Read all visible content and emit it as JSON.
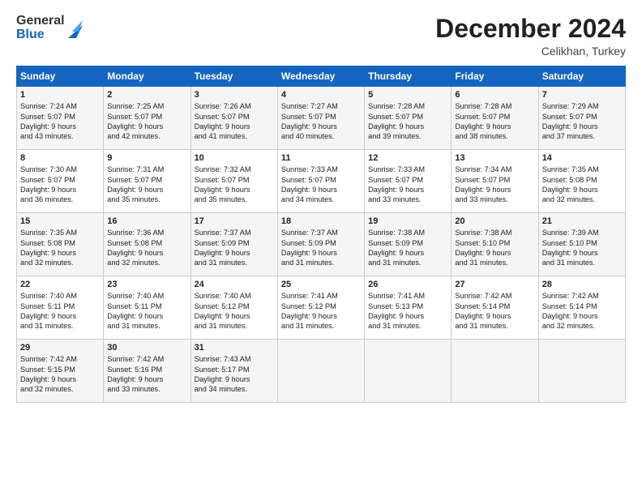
{
  "logo": {
    "line1": "General",
    "line2": "Blue"
  },
  "header": {
    "month": "December 2024",
    "location": "Celikhan, Turkey"
  },
  "weekdays": [
    "Sunday",
    "Monday",
    "Tuesday",
    "Wednesday",
    "Thursday",
    "Friday",
    "Saturday"
  ],
  "weeks": [
    [
      {
        "day": "1",
        "lines": [
          "Sunrise: 7:24 AM",
          "Sunset: 5:07 PM",
          "Daylight: 9 hours",
          "and 43 minutes."
        ]
      },
      {
        "day": "2",
        "lines": [
          "Sunrise: 7:25 AM",
          "Sunset: 5:07 PM",
          "Daylight: 9 hours",
          "and 42 minutes."
        ]
      },
      {
        "day": "3",
        "lines": [
          "Sunrise: 7:26 AM",
          "Sunset: 5:07 PM",
          "Daylight: 9 hours",
          "and 41 minutes."
        ]
      },
      {
        "day": "4",
        "lines": [
          "Sunrise: 7:27 AM",
          "Sunset: 5:07 PM",
          "Daylight: 9 hours",
          "and 40 minutes."
        ]
      },
      {
        "day": "5",
        "lines": [
          "Sunrise: 7:28 AM",
          "Sunset: 5:07 PM",
          "Daylight: 9 hours",
          "and 39 minutes."
        ]
      },
      {
        "day": "6",
        "lines": [
          "Sunrise: 7:28 AM",
          "Sunset: 5:07 PM",
          "Daylight: 9 hours",
          "and 38 minutes."
        ]
      },
      {
        "day": "7",
        "lines": [
          "Sunrise: 7:29 AM",
          "Sunset: 5:07 PM",
          "Daylight: 9 hours",
          "and 37 minutes."
        ]
      }
    ],
    [
      {
        "day": "8",
        "lines": [
          "Sunrise: 7:30 AM",
          "Sunset: 5:07 PM",
          "Daylight: 9 hours",
          "and 36 minutes."
        ]
      },
      {
        "day": "9",
        "lines": [
          "Sunrise: 7:31 AM",
          "Sunset: 5:07 PM",
          "Daylight: 9 hours",
          "and 35 minutes."
        ]
      },
      {
        "day": "10",
        "lines": [
          "Sunrise: 7:32 AM",
          "Sunset: 5:07 PM",
          "Daylight: 9 hours",
          "and 35 minutes."
        ]
      },
      {
        "day": "11",
        "lines": [
          "Sunrise: 7:33 AM",
          "Sunset: 5:07 PM",
          "Daylight: 9 hours",
          "and 34 minutes."
        ]
      },
      {
        "day": "12",
        "lines": [
          "Sunrise: 7:33 AM",
          "Sunset: 5:07 PM",
          "Daylight: 9 hours",
          "and 33 minutes."
        ]
      },
      {
        "day": "13",
        "lines": [
          "Sunrise: 7:34 AM",
          "Sunset: 5:07 PM",
          "Daylight: 9 hours",
          "and 33 minutes."
        ]
      },
      {
        "day": "14",
        "lines": [
          "Sunrise: 7:35 AM",
          "Sunset: 5:08 PM",
          "Daylight: 9 hours",
          "and 32 minutes."
        ]
      }
    ],
    [
      {
        "day": "15",
        "lines": [
          "Sunrise: 7:35 AM",
          "Sunset: 5:08 PM",
          "Daylight: 9 hours",
          "and 32 minutes."
        ]
      },
      {
        "day": "16",
        "lines": [
          "Sunrise: 7:36 AM",
          "Sunset: 5:08 PM",
          "Daylight: 9 hours",
          "and 32 minutes."
        ]
      },
      {
        "day": "17",
        "lines": [
          "Sunrise: 7:37 AM",
          "Sunset: 5:09 PM",
          "Daylight: 9 hours",
          "and 31 minutes."
        ]
      },
      {
        "day": "18",
        "lines": [
          "Sunrise: 7:37 AM",
          "Sunset: 5:09 PM",
          "Daylight: 9 hours",
          "and 31 minutes."
        ]
      },
      {
        "day": "19",
        "lines": [
          "Sunrise: 7:38 AM",
          "Sunset: 5:09 PM",
          "Daylight: 9 hours",
          "and 31 minutes."
        ]
      },
      {
        "day": "20",
        "lines": [
          "Sunrise: 7:38 AM",
          "Sunset: 5:10 PM",
          "Daylight: 9 hours",
          "and 31 minutes."
        ]
      },
      {
        "day": "21",
        "lines": [
          "Sunrise: 7:39 AM",
          "Sunset: 5:10 PM",
          "Daylight: 9 hours",
          "and 31 minutes."
        ]
      }
    ],
    [
      {
        "day": "22",
        "lines": [
          "Sunrise: 7:40 AM",
          "Sunset: 5:11 PM",
          "Daylight: 9 hours",
          "and 31 minutes."
        ]
      },
      {
        "day": "23",
        "lines": [
          "Sunrise: 7:40 AM",
          "Sunset: 5:11 PM",
          "Daylight: 9 hours",
          "and 31 minutes."
        ]
      },
      {
        "day": "24",
        "lines": [
          "Sunrise: 7:40 AM",
          "Sunset: 5:12 PM",
          "Daylight: 9 hours",
          "and 31 minutes."
        ]
      },
      {
        "day": "25",
        "lines": [
          "Sunrise: 7:41 AM",
          "Sunset: 5:12 PM",
          "Daylight: 9 hours",
          "and 31 minutes."
        ]
      },
      {
        "day": "26",
        "lines": [
          "Sunrise: 7:41 AM",
          "Sunset: 5:13 PM",
          "Daylight: 9 hours",
          "and 31 minutes."
        ]
      },
      {
        "day": "27",
        "lines": [
          "Sunrise: 7:42 AM",
          "Sunset: 5:14 PM",
          "Daylight: 9 hours",
          "and 31 minutes."
        ]
      },
      {
        "day": "28",
        "lines": [
          "Sunrise: 7:42 AM",
          "Sunset: 5:14 PM",
          "Daylight: 9 hours",
          "and 32 minutes."
        ]
      }
    ],
    [
      {
        "day": "29",
        "lines": [
          "Sunrise: 7:42 AM",
          "Sunset: 5:15 PM",
          "Daylight: 9 hours",
          "and 32 minutes."
        ]
      },
      {
        "day": "30",
        "lines": [
          "Sunrise: 7:42 AM",
          "Sunset: 5:16 PM",
          "Daylight: 9 hours",
          "and 33 minutes."
        ]
      },
      {
        "day": "31",
        "lines": [
          "Sunrise: 7:43 AM",
          "Sunset: 5:17 PM",
          "Daylight: 9 hours",
          "and 34 minutes."
        ]
      },
      null,
      null,
      null,
      null
    ]
  ]
}
